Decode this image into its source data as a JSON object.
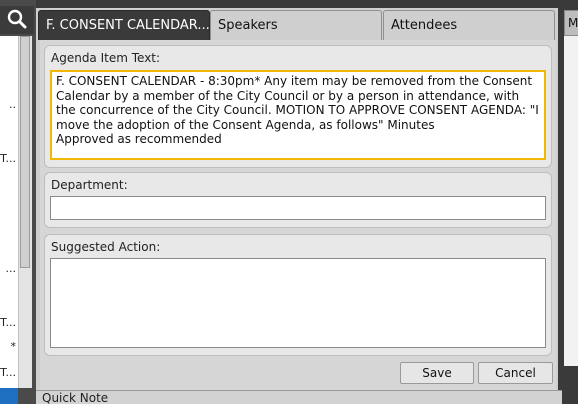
{
  "colors": {
    "active_tab_bg": "#3a3a3a",
    "focus_border": "#f2b705",
    "selection_blue": "#1f6fc0"
  },
  "left_panel": {
    "search_icon": "search-icon",
    "rows": [
      "..",
      "T...",
      "...",
      "T...",
      "*",
      "T..."
    ]
  },
  "right_stub": {
    "tab_label": "M"
  },
  "tabs": [
    {
      "label": "F. CONSENT CALENDAR...",
      "active": true
    },
    {
      "label": "Speakers",
      "active": false
    },
    {
      "label": "Attendees",
      "active": false
    }
  ],
  "agenda": {
    "label": "Agenda Item Text:",
    "text": "F. CONSENT CALENDAR - 8:30pm* Any item may be removed from the Consent Calendar by a member of the City Council or by a person in attendance, with the concurrence of the City Council. MOTION TO APPROVE CONSENT AGENDA: \"I move the adoption of the Consent Agenda, as follows\" Minutes\nApproved as recommended"
  },
  "department": {
    "label": "Department:",
    "value": ""
  },
  "suggested_action": {
    "label": "Suggested Action:",
    "value": ""
  },
  "buttons": {
    "save": "Save",
    "cancel": "Cancel"
  },
  "bottom": {
    "label": "Quick Note"
  }
}
